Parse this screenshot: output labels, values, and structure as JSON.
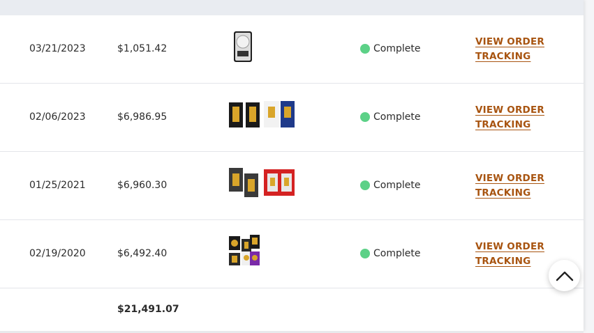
{
  "orders": [
    {
      "date": "03/21/2023",
      "amount": "$1,051.42",
      "status": "Complete",
      "link": "VIEW ORDER TRACKING",
      "thumbs": [
        "silver-coin-thumbnail"
      ]
    },
    {
      "date": "02/06/2023",
      "amount": "$6,986.95",
      "status": "Complete",
      "link": "VIEW ORDER TRACKING",
      "thumbs": [
        "gold-bar-pair-thumbnail",
        "gold-bar-card-thumbnail"
      ]
    },
    {
      "date": "01/25/2021",
      "amount": "$6,960.30",
      "status": "Complete",
      "link": "VIEW ORDER TRACKING",
      "thumbs": [
        "gold-bar-pair-thumbnail",
        "red-gold-card-thumbnail"
      ]
    },
    {
      "date": "02/19/2020",
      "amount": "$6,492.40",
      "status": "Complete",
      "link": "VIEW ORDER TRACKING",
      "thumbs": [
        "mixed-gold-products-thumbnail"
      ]
    }
  ],
  "total": "$21,491.07",
  "colors": {
    "status_complete": "#5cd187",
    "link": "#a85410"
  },
  "icons": {
    "scroll_top": "chevron-up-icon"
  }
}
